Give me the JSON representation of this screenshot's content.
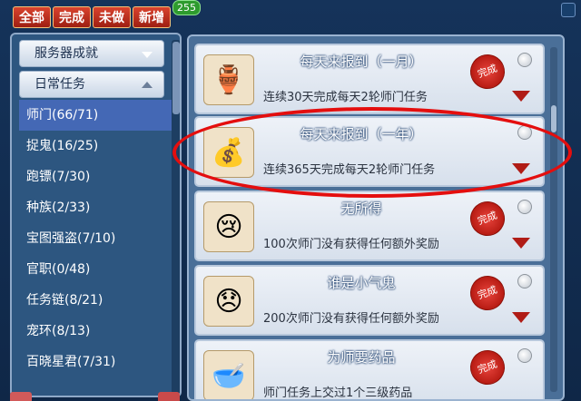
{
  "tabs": [
    "全部",
    "完成",
    "未做",
    "新增"
  ],
  "badge": "255",
  "categories": [
    {
      "label": "服务器成就"
    },
    {
      "label": "日常任务"
    }
  ],
  "subitems": [
    {
      "label": "师门(66/71)"
    },
    {
      "label": "捉鬼(16/25)"
    },
    {
      "label": "跑镖(7/30)"
    },
    {
      "label": "种族(2/33)"
    },
    {
      "label": "宝图强盗(7/10)"
    },
    {
      "label": "官职(0/48)"
    },
    {
      "label": "任务链(8/21)"
    },
    {
      "label": "宠环(8/13)"
    },
    {
      "label": "百晓星君(7/31)"
    }
  ],
  "achievements": [
    {
      "title": "每天来报到（一月）",
      "desc": "连续30天完成每天2轮师门任务",
      "stamp": "完成",
      "icon": "gold-cauldron-icon"
    },
    {
      "title": "每天来报到（一年）",
      "desc": "连续365天完成每天2轮师门任务",
      "stamp": "",
      "icon": "treasure-cauldron-icon"
    },
    {
      "title": "无所得",
      "desc": "100次师门没有获得任何额外奖励",
      "stamp": "完成",
      "icon": "crying-face-icon"
    },
    {
      "title": "谁是小气鬼",
      "desc": "200次师门没有获得任何额外奖励",
      "stamp": "完成",
      "icon": "sad-face-icon"
    },
    {
      "title": "为师要药品",
      "desc": "师门任务上交过1个三级药品",
      "stamp": "完成",
      "icon": "medicine-bowl-icon"
    }
  ]
}
